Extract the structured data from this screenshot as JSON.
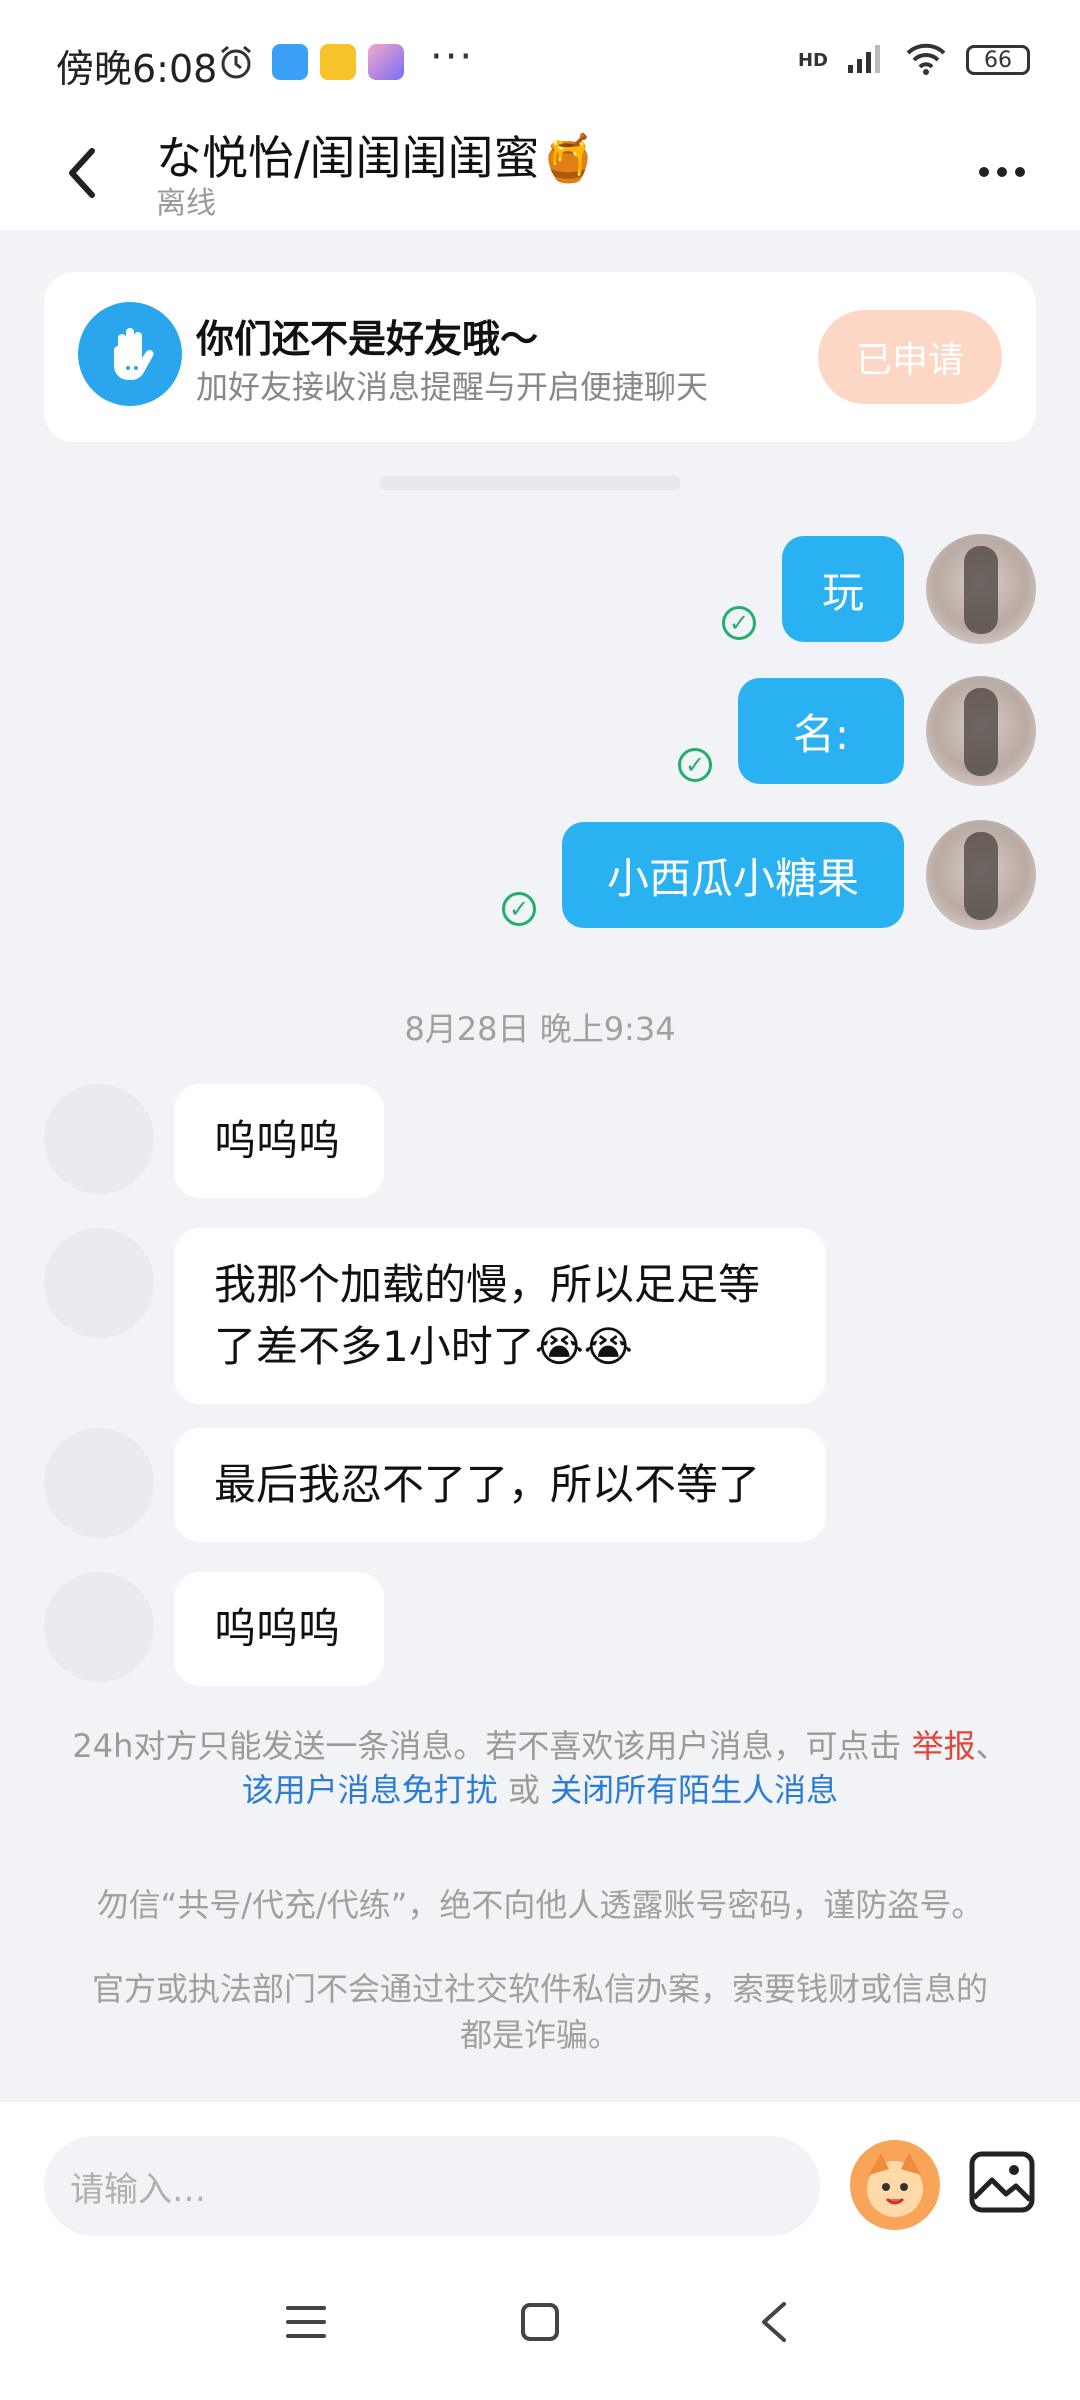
{
  "status_bar": {
    "time": "傍晚6:08",
    "battery": "66",
    "network": "HD",
    "more_indicator": "···",
    "app_icon_colors": [
      "#3aa0f5",
      "#f8c32a",
      "#7b6cf6"
    ]
  },
  "header": {
    "title": "な悦怡/闺闺闺闺蜜🍯",
    "status": "离线"
  },
  "friend_card": {
    "title": "你们还不是好友哦～",
    "subtitle": "加好友接收消息提醒与开启便捷聊天",
    "button_label": "已申请"
  },
  "sent_messages": [
    {
      "text": "玩",
      "status": "sent"
    },
    {
      "text": "名:",
      "status": "sent"
    },
    {
      "text": "小西瓜小糖果",
      "status": "sent"
    }
  ],
  "timestamp": "8月28日 晚上9:34",
  "received_messages": [
    {
      "text": "呜呜呜"
    },
    {
      "text": "我那个加载的慢，所以足足等了差不多1小时了😭😭"
    },
    {
      "text": "最后我忍不了了，所以不等了"
    },
    {
      "text": "呜呜呜"
    }
  ],
  "notice": {
    "prefix": "24h对方只能发送一条消息。若不喜欢该用户消息，可点击 ",
    "report_link": "举报",
    "separator": "、",
    "mute_link": "该用户消息免打扰",
    "or_text": " 或 ",
    "close_link": "关闭所有陌生人消息"
  },
  "warnings": [
    "勿信“共号/代充/代练”，绝不向他人透露账号密码，谨防盗号。",
    "官方或执法部门不会通过社交软件私信办案，索要钱财或信息的都是诈骗。"
  ],
  "input": {
    "placeholder": "请输入…"
  },
  "colors": {
    "accent_blue": "#2ab1f2",
    "applied_button": "#fcd7c6",
    "report_red": "#e0473a",
    "link_blue": "#2a7dd6",
    "check_green": "#21b06b"
  },
  "icons": {
    "back": "chevron-left-icon",
    "more": "more-horizontal-icon",
    "wave": "waving-hand-icon",
    "check": "check-circle-icon",
    "emoji": "emoji-face-icon",
    "image": "image-icon",
    "nav_menu": "menu-icon",
    "nav_home": "home-square-icon",
    "nav_back": "back-triangle-icon"
  }
}
